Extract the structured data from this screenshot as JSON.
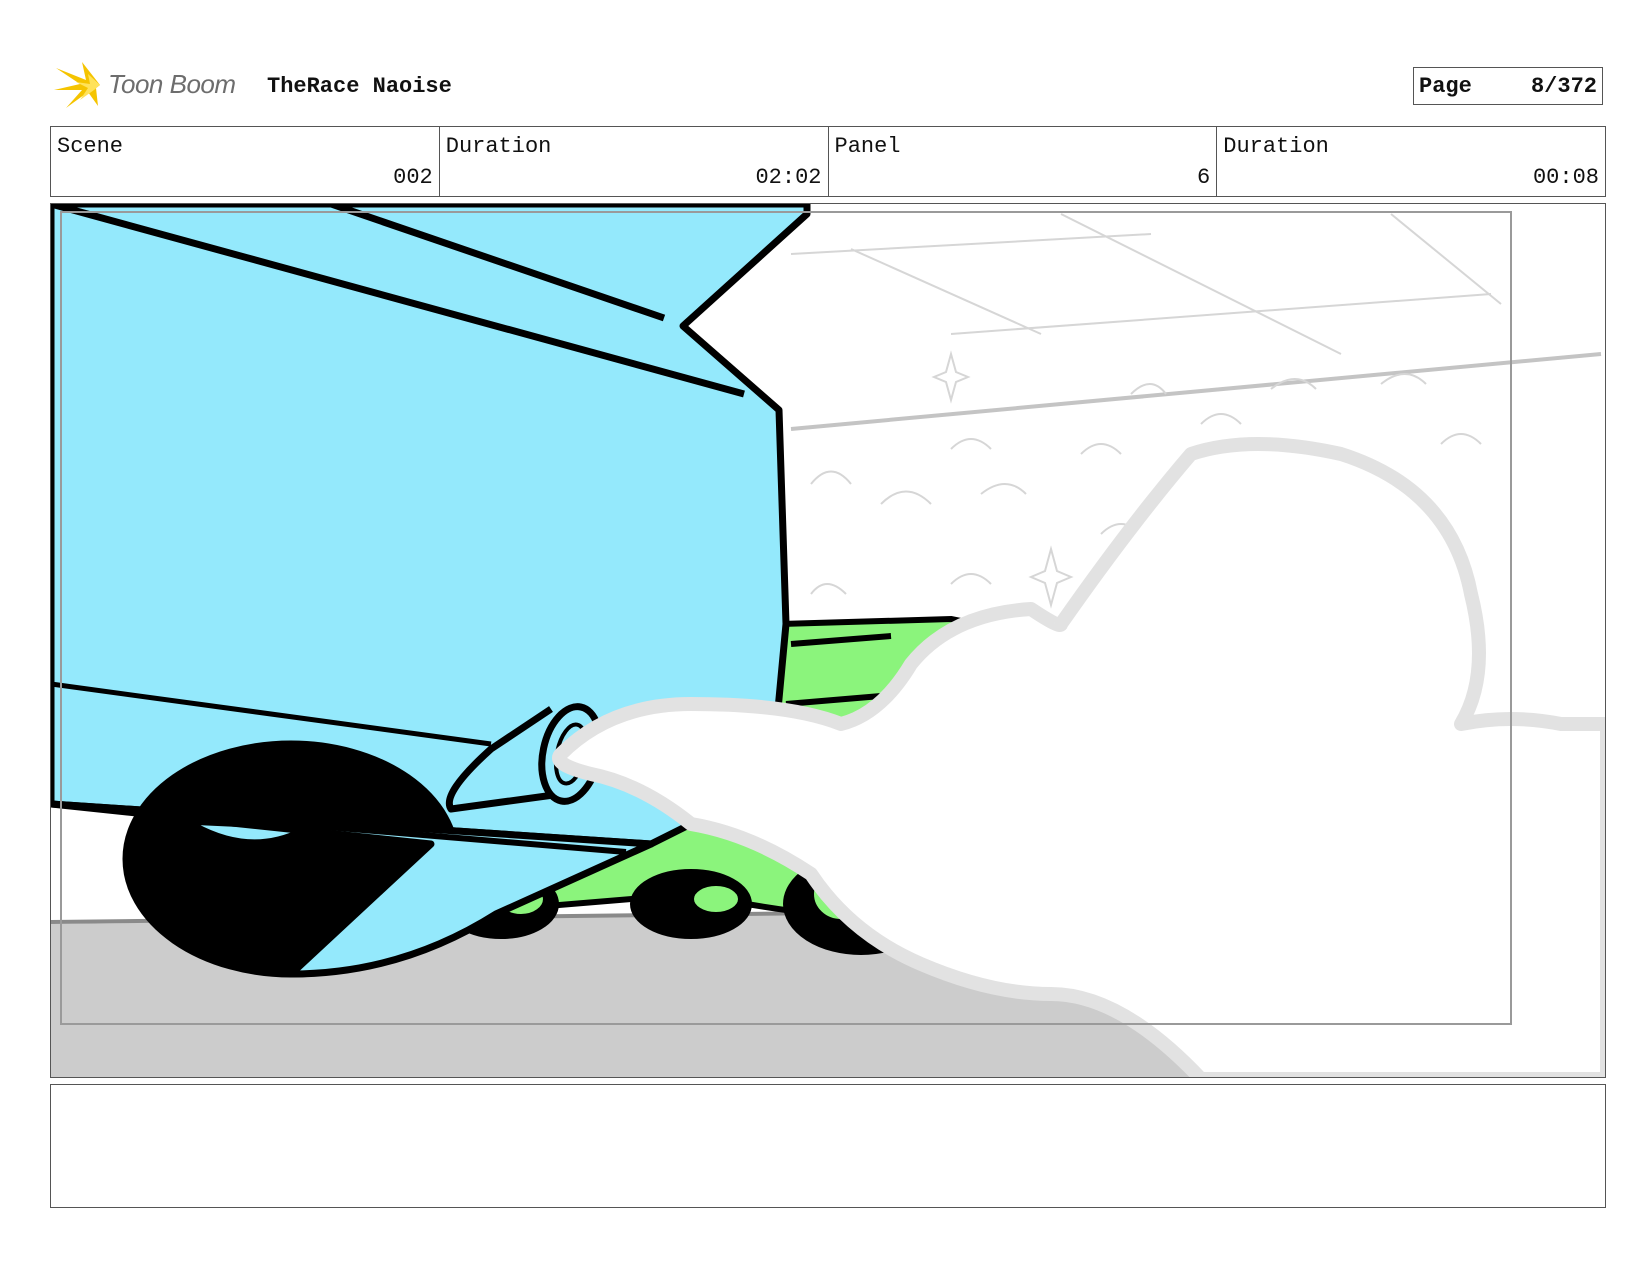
{
  "header": {
    "logo_text": "Toon Boom",
    "project_title": "TheRace Naoise"
  },
  "page": {
    "label": "Page",
    "value": "8/372"
  },
  "info": [
    {
      "label": "Scene",
      "value": "002"
    },
    {
      "label": "Duration",
      "value": "02:02"
    },
    {
      "label": "Panel",
      "value": "6"
    },
    {
      "label": "Duration",
      "value": "00:08"
    }
  ],
  "panel": {
    "image_name": "storyboard-panel-car-exhaust",
    "colors": {
      "car_body": "#94e9fc",
      "green_car": "#8bf47c",
      "ground": "#cccccc",
      "smoke_outline": "#e2e2e2",
      "sketch_lines": "#cfcfcf"
    }
  },
  "notes": {
    "text": ""
  }
}
